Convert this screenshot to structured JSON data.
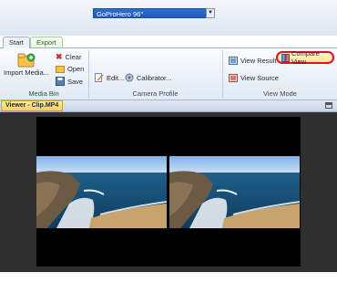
{
  "tabs": [
    {
      "label": "Start"
    },
    {
      "label": "Export"
    }
  ],
  "media_bin": {
    "import_label": "Import Media...",
    "clear_label": "Clear",
    "open_label": "Open",
    "save_label": "Save",
    "group_label": "Media Bin"
  },
  "camera_profile": {
    "selected": "GoProHero 96°",
    "edit_label": "Edit...",
    "calibrator_label": "Calibrator...",
    "group_label": "Camera Profile"
  },
  "view_mode": {
    "view_result_label": "View Result",
    "view_source_label": "View Source",
    "compare_view_label": "Compare View",
    "group_label": "View Mode"
  },
  "viewer": {
    "title": "Viewer - Clip.MP4"
  },
  "colors": {
    "accent": "#1f5bb6",
    "highlight_ring": "#e0102a",
    "viewer_tab": "#f6cf5e"
  },
  "icons": [
    "import-media-icon",
    "clear-icon",
    "open-icon",
    "save-icon",
    "edit-icon",
    "calibrator-icon",
    "view-result-icon",
    "view-source-icon",
    "compare-view-icon",
    "maximize-icon"
  ]
}
